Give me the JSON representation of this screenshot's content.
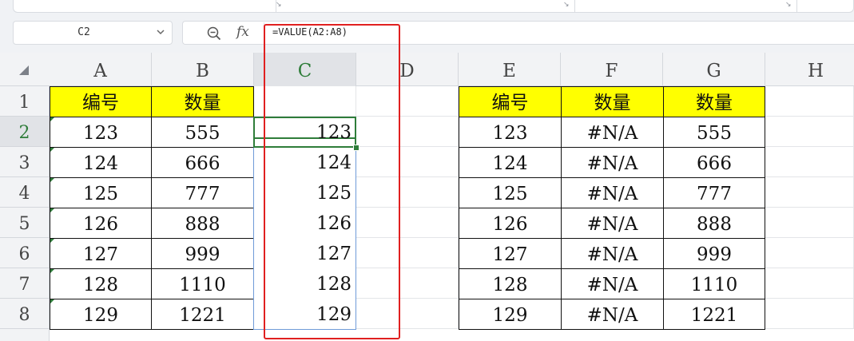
{
  "formula_bar": {
    "cell_reference": "C2",
    "fx_symbol": "fx",
    "formula": "=VALUE(A2:A8)"
  },
  "columns": [
    "A",
    "B",
    "C",
    "D",
    "E",
    "F",
    "G",
    "H"
  ],
  "rows": [
    "1",
    "2",
    "3",
    "4",
    "5",
    "6",
    "7",
    "8"
  ],
  "active_cell": {
    "column": "C",
    "row": "2"
  },
  "highlight_color": "#e02020",
  "table_left": {
    "headers": [
      "编号",
      "数量"
    ],
    "rows": [
      [
        "123",
        "555"
      ],
      [
        "124",
        "666"
      ],
      [
        "125",
        "777"
      ],
      [
        "126",
        "888"
      ],
      [
        "127",
        "999"
      ],
      [
        "128",
        "1110"
      ],
      [
        "129",
        "1221"
      ]
    ]
  },
  "column_c": {
    "values": [
      "123",
      "124",
      "125",
      "126",
      "127",
      "128",
      "129"
    ]
  },
  "table_right": {
    "headers": [
      "编号",
      "数量",
      "数量"
    ],
    "rows": [
      [
        "123",
        "#N/A",
        "555"
      ],
      [
        "124",
        "#N/A",
        "666"
      ],
      [
        "125",
        "#N/A",
        "777"
      ],
      [
        "126",
        "#N/A",
        "888"
      ],
      [
        "127",
        "#N/A",
        "999"
      ],
      [
        "128",
        "#N/A",
        "1110"
      ],
      [
        "129",
        "#N/A",
        "1221"
      ]
    ]
  }
}
